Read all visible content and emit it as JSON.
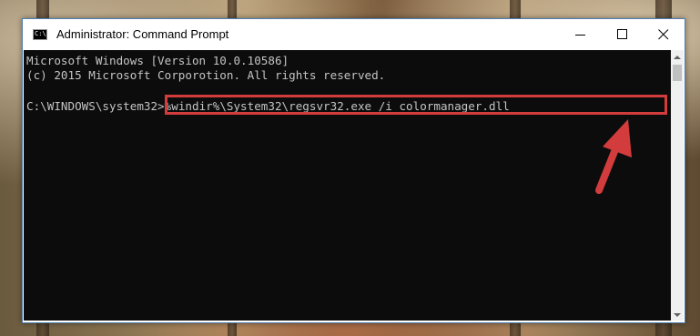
{
  "window": {
    "title": "Administrator: Command Prompt",
    "icon_text": "C:\\",
    "controls": {
      "minimize": "minimize-icon",
      "maximize": "maximize-icon",
      "close": "close-icon"
    }
  },
  "console": {
    "lines": [
      "Microsoft Windows [Version 10.0.10586]",
      "(c) 2015 Microsoft Corporotion. All rights reserved."
    ],
    "prompt": "C:\\WINDOWS\\system32>",
    "command": "%windir%\\System32\\regsvr32.exe /i colormanager.dll"
  },
  "annotations": {
    "highlight_color": "#d23c3c",
    "arrow_color": "#d23c3c"
  },
  "colors": {
    "console_bg": "#0c0c0c",
    "console_text": "#c4c4c4"
  }
}
